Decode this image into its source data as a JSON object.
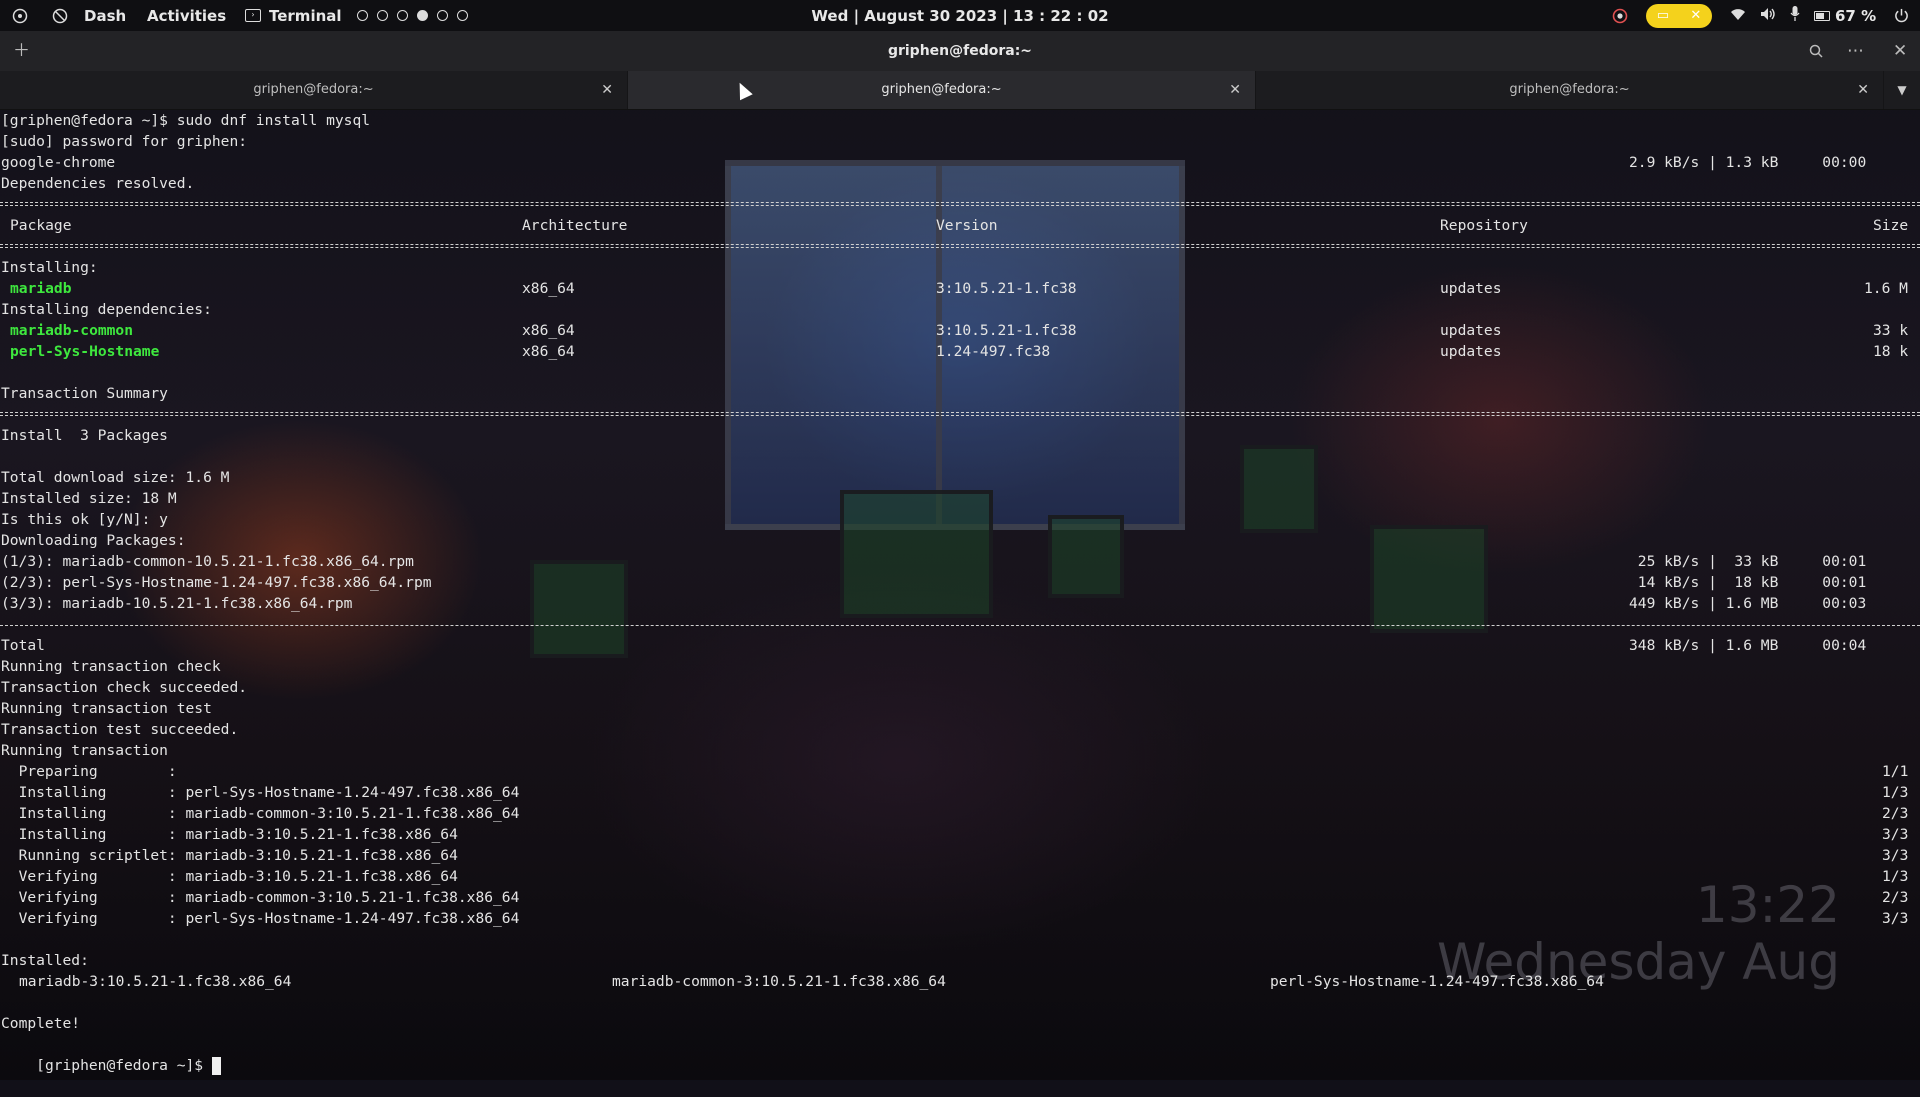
{
  "topbar": {
    "dash": "Dash",
    "activities": "Activities",
    "app_name": "Terminal",
    "workspaces": [
      false,
      false,
      false,
      true,
      false,
      false
    ],
    "clock": "Wed | August 30 2023 | 13 : 22 : 02",
    "battery": "67 %"
  },
  "window": {
    "title": "griphen@fedora:~",
    "tabs": [
      {
        "label": "griphen@fedora:~",
        "active": false
      },
      {
        "label": "griphen@fedora:~",
        "active": true
      },
      {
        "label": "griphen@fedora:~",
        "active": false
      }
    ]
  },
  "terminal": {
    "prompt_cmd": "[griphen@fedora ~]$ sudo dnf install mysql",
    "sudo": "[sudo] password for griphen:",
    "repo_line": {
      "name": "google-chrome",
      "stats": "2.9 kB/s | 1.3 kB     00:00"
    },
    "deps_resolved": "Dependencies resolved.",
    "table_headers": {
      "package": "Package",
      "arch": "Architecture",
      "version": "Version",
      "repo": "Repository",
      "size": "Size"
    },
    "installing_label": "Installing:",
    "installing_deps_label": "Installing dependencies:",
    "packages": [
      {
        "name": "mariadb",
        "arch": "x86_64",
        "version": "3:10.5.21-1.fc38",
        "repo": "updates",
        "size": "1.6 M"
      },
      {
        "name": "mariadb-common",
        "arch": "x86_64",
        "version": "3:10.5.21-1.fc38",
        "repo": "updates",
        "size": "33 k"
      },
      {
        "name": "perl-Sys-Hostname",
        "arch": "x86_64",
        "version": "1.24-497.fc38",
        "repo": "updates",
        "size": "18 k"
      }
    ],
    "transaction_summary": "Transaction Summary",
    "install_count": "Install  3 Packages",
    "total_download": "Total download size: 1.6 M",
    "installed_size": "Installed size: 18 M",
    "confirm": "Is this ok [y/N]: y",
    "downloading": "Downloading Packages:",
    "downloads": [
      {
        "file": "(1/3): mariadb-common-10.5.21-1.fc38.x86_64.rpm",
        "stats": " 25 kB/s |  33 kB     00:01"
      },
      {
        "file": "(2/3): perl-Sys-Hostname-1.24-497.fc38.x86_64.rpm",
        "stats": " 14 kB/s |  18 kB     00:01"
      },
      {
        "file": "(3/3): mariadb-10.5.21-1.fc38.x86_64.rpm",
        "stats": "449 kB/s | 1.6 MB     00:03"
      }
    ],
    "total": {
      "label": "Total",
      "stats": "348 kB/s | 1.6 MB     00:04"
    },
    "steps": [
      "Running transaction check",
      "Transaction check succeeded.",
      "Running transaction test",
      "Transaction test succeeded.",
      "Running transaction"
    ],
    "actions": [
      {
        "text": "  Preparing        :",
        "count": "1/1"
      },
      {
        "text": "  Installing       : perl-Sys-Hostname-1.24-497.fc38.x86_64",
        "count": "1/3"
      },
      {
        "text": "  Installing       : mariadb-common-3:10.5.21-1.fc38.x86_64",
        "count": "2/3"
      },
      {
        "text": "  Installing       : mariadb-3:10.5.21-1.fc38.x86_64",
        "count": "3/3"
      },
      {
        "text": "  Running scriptlet: mariadb-3:10.5.21-1.fc38.x86_64",
        "count": "3/3"
      },
      {
        "text": "  Verifying        : mariadb-3:10.5.21-1.fc38.x86_64",
        "count": "1/3"
      },
      {
        "text": "  Verifying        : mariadb-common-3:10.5.21-1.fc38.x86_64",
        "count": "2/3"
      },
      {
        "text": "  Verifying        : perl-Sys-Hostname-1.24-497.fc38.x86_64",
        "count": "3/3"
      }
    ],
    "installed_label": "Installed:",
    "installed": [
      "mariadb-3:10.5.21-1.fc38.x86_64",
      "mariadb-common-3:10.5.21-1.fc38.x86_64",
      "perl-Sys-Hostname-1.24-497.fc38.x86_64"
    ],
    "complete": "Complete!",
    "final_prompt": "[griphen@fedora ~]$"
  },
  "desktop_clock": {
    "time": "13:22",
    "date": "Wednesday Aug"
  }
}
